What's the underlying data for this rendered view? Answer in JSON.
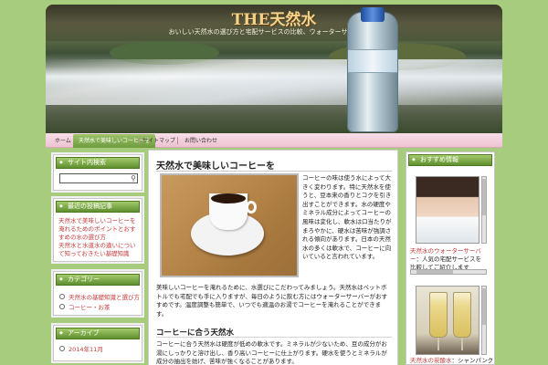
{
  "header": {
    "title": "THE天然水",
    "subtitle": "おいしい天然水の選び方と宅配サービスの比較、ウォーターサーバー情報"
  },
  "nav": {
    "items": [
      {
        "label": "ホーム"
      },
      {
        "label": "天然水で美味しいコーヒーを",
        "active": true
      },
      {
        "label": "サイトマップ"
      },
      {
        "label": "お問い合わせ"
      }
    ]
  },
  "left": {
    "search": {
      "heading": "サイト内検索",
      "placeholder": ""
    },
    "recent": {
      "heading": "最近の投稿記事",
      "links": [
        "天然水で美味しいコーヒーを淹れるためのポイントとおすすめの水の選び方",
        "天然水と水道水の違いについて知っておきたい基礎知識"
      ]
    },
    "categories": {
      "heading": "カテゴリー",
      "items": [
        "天然水の基礎知識と選び方",
        "コーヒー・お茶"
      ]
    },
    "archives": {
      "heading": "アーカイブ",
      "items": [
        "2014年11月"
      ]
    }
  },
  "main": {
    "title": "天然水で美味しいコーヒーを",
    "right_paragraph": "コーヒーの味は使う水によって大きく変わります。特に天然水を使うと、豆本来の香りとコクを引き出すことができます。水の硬度やミネラル成分によってコーヒーの風味は変化し、軟水は口当たりがまろやかに、硬水は苦味が強調される傾向があります。日本の天然水の多くは軟水で、コーヒーに向いていると言われています。",
    "below_paragraph": "美味しいコーヒーを淹れるために、水選びにこだわってみましょう。天然水はペットボトルでも宅配でも手に入りますが、毎日のように飲む方にはウォーターサーバーがおすすめです。温度調整も簡単で、いつでも適温のお湯でコーヒーを淹れることができます。",
    "subheading": "コーヒーに合う天然水",
    "sub_paragraph": "コーヒーに合う天然水は硬度が低めの軟水です。ミネラルが少ないため、豆の成分がお湯にしっかりと溶け出し、香り高いコーヒーに仕上がります。硬水を使うとミネラルが成分の抽出を妨げ、苦味が強くなることがあります。"
  },
  "right": {
    "heading": "おすすめ情報",
    "items": [
      {
        "link": "天然水のウォーターサーバー",
        "text": "：人気の宅配サービスを比較してご紹介します"
      },
      {
        "link": "天然水の炭酸水",
        "text": "：シャンパングラスで楽しむ"
      }
    ]
  },
  "colors": {
    "background": "#a8cc7e",
    "accent_green": "#6e9a3d",
    "link_red": "#c43b3b",
    "nav_pink": "#eec2d2"
  }
}
